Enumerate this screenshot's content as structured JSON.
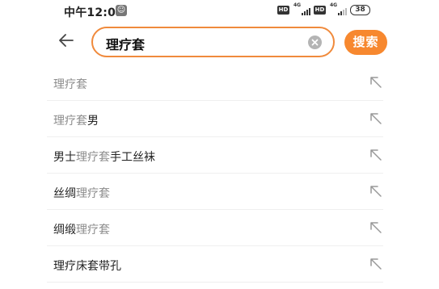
{
  "status_bar": {
    "time": "中午12:01",
    "network_1": "4G",
    "network_2": "4G",
    "hd_1": "HD",
    "hd_2": "HD",
    "battery": "38"
  },
  "search": {
    "query": "理疗套",
    "submit_label": "搜索",
    "accent_color": "#f7882f"
  },
  "suggestions": [
    {
      "prefix": "",
      "highlight": "理疗套",
      "suffix": ""
    },
    {
      "prefix": "",
      "highlight": "理疗套",
      "suffix": "男"
    },
    {
      "prefix": "男士",
      "highlight": "理疗套",
      "suffix": "手工丝袜"
    },
    {
      "prefix": "丝绸",
      "highlight": "理疗套",
      "suffix": ""
    },
    {
      "prefix": "绸缎",
      "highlight": "理疗套",
      "suffix": ""
    },
    {
      "prefix": "理疗床套带孔",
      "highlight": "",
      "suffix": ""
    }
  ],
  "icons": {
    "back": "arrow-left-icon",
    "clear": "clear-x-icon",
    "fill_suggestion": "arrow-up-left-icon"
  }
}
